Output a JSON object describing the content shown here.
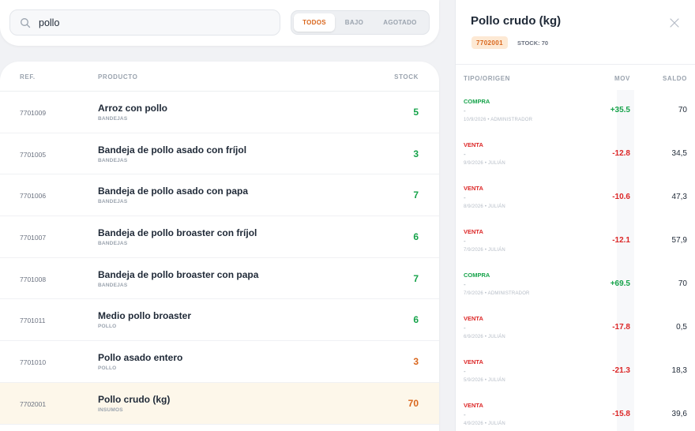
{
  "search": {
    "value": "pollo",
    "placeholder": ""
  },
  "filters": [
    {
      "label": "TODOS",
      "active": true
    },
    {
      "label": "BAJO",
      "active": false
    },
    {
      "label": "AGOTADO",
      "active": false
    }
  ],
  "products": {
    "columns": {
      "ref": "REF.",
      "product": "PRODUCTO",
      "stock": "STOCK"
    },
    "rows": [
      {
        "ref": "7701009",
        "name": "Arroz con pollo",
        "category": "BANDEJAS",
        "stock": "5",
        "status": "ok"
      },
      {
        "ref": "7701005",
        "name": "Bandeja de pollo asado con fríjol",
        "category": "BANDEJAS",
        "stock": "3",
        "status": "ok"
      },
      {
        "ref": "7701006",
        "name": "Bandeja de pollo asado con papa",
        "category": "BANDEJAS",
        "stock": "7",
        "status": "ok"
      },
      {
        "ref": "7701007",
        "name": "Bandeja de pollo broaster con fríjol",
        "category": "BANDEJAS",
        "stock": "6",
        "status": "ok"
      },
      {
        "ref": "7701008",
        "name": "Bandeja de pollo broaster con papa",
        "category": "BANDEJAS",
        "stock": "7",
        "status": "ok"
      },
      {
        "ref": "7701011",
        "name": "Medio pollo broaster",
        "category": "POLLO",
        "stock": "6",
        "status": "ok"
      },
      {
        "ref": "7701010",
        "name": "Pollo asado entero",
        "category": "POLLO",
        "stock": "3",
        "status": "low"
      },
      {
        "ref": "7702001",
        "name": "Pollo crudo (kg)",
        "category": "INSUMOS",
        "stock": "70",
        "status": "low",
        "selected": true
      }
    ]
  },
  "detail": {
    "title": "Pollo crudo (kg)",
    "ref_badge": "7702001",
    "stock_label": "STOCK: 70",
    "columns": {
      "type": "TIPO/ORIGEN",
      "mov": "MOV",
      "saldo": "SALDO"
    },
    "movements": [
      {
        "type": "COMPRA",
        "origin": "-",
        "meta": "10/9/2026 • ADMINISTRADOR",
        "mov": "+35.5",
        "saldo": "70"
      },
      {
        "type": "VENTA",
        "origin": "-",
        "meta": "9/9/2026 • JULIÁN",
        "mov": "-12.8",
        "saldo": "34,5"
      },
      {
        "type": "VENTA",
        "origin": "-",
        "meta": "8/9/2026 • JULIÁN",
        "mov": "-10.6",
        "saldo": "47,3"
      },
      {
        "type": "VENTA",
        "origin": "-",
        "meta": "7/9/2026 • JULIÁN",
        "mov": "-12.1",
        "saldo": "57,9"
      },
      {
        "type": "COMPRA",
        "origin": "-",
        "meta": "7/9/2026 • ADMINISTRADOR",
        "mov": "+69.5",
        "saldo": "70"
      },
      {
        "type": "VENTA",
        "origin": "-",
        "meta": "6/9/2026 • JULIÁN",
        "mov": "-17.8",
        "saldo": "0,5"
      },
      {
        "type": "VENTA",
        "origin": "-",
        "meta": "5/9/2026 • JULIÁN",
        "mov": "-21.3",
        "saldo": "18,3"
      },
      {
        "type": "VENTA",
        "origin": "-",
        "meta": "4/9/2026 • JULIÁN",
        "mov": "-15.8",
        "saldo": "39,6"
      }
    ]
  },
  "colors": {
    "accent": "#d9661c",
    "positive": "#16a34a",
    "negative": "#dc2626",
    "selected_row": "#fdf7ea"
  },
  "icons": {
    "search": "search-icon",
    "close": "close-icon"
  }
}
